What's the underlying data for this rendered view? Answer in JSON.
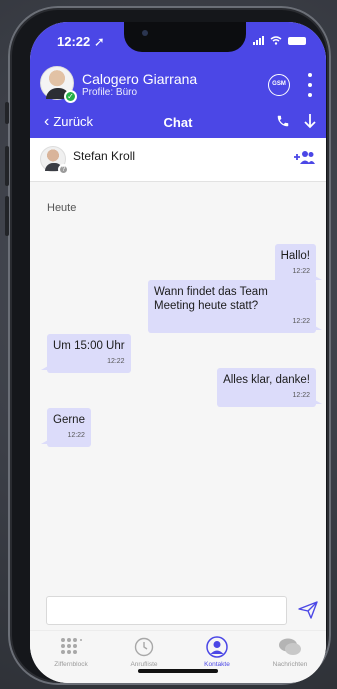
{
  "status_bar": {
    "time": "12:22"
  },
  "header": {
    "profile_name": "Calogero Giarrana",
    "profile_sub": "Profile: Büro",
    "gsm_label": "GSM",
    "back_label": "Zurück",
    "title": "Chat"
  },
  "contact": {
    "name": "Stefan Kroll"
  },
  "chat": {
    "day_header": "Heute",
    "messages": [
      {
        "direction": "out",
        "text": "Hallo!",
        "time": "12:22"
      },
      {
        "direction": "out",
        "text": "Wann findet das Team Meeting heute statt?",
        "time": "12:22"
      },
      {
        "direction": "in",
        "text": "Um 15:00 Uhr",
        "time": "12:22"
      },
      {
        "direction": "out",
        "text": "Alles klar, danke!",
        "time": "12:22"
      },
      {
        "direction": "in",
        "text": "Gerne",
        "time": "12:22"
      }
    ]
  },
  "composer": {
    "placeholder": "",
    "value": ""
  },
  "tabs": [
    {
      "label": "Ziffernblock",
      "icon": "keypad-icon",
      "active": false
    },
    {
      "label": "Anrufliste",
      "icon": "call-history-icon",
      "active": false
    },
    {
      "label": "Kontakte",
      "icon": "contacts-icon",
      "active": true
    },
    {
      "label": "Nachrichten",
      "icon": "messages-icon",
      "active": false
    }
  ],
  "colors": {
    "accent": "#4b47e6",
    "bubble": "#dcdcfa",
    "presence_online": "#25b04a"
  }
}
